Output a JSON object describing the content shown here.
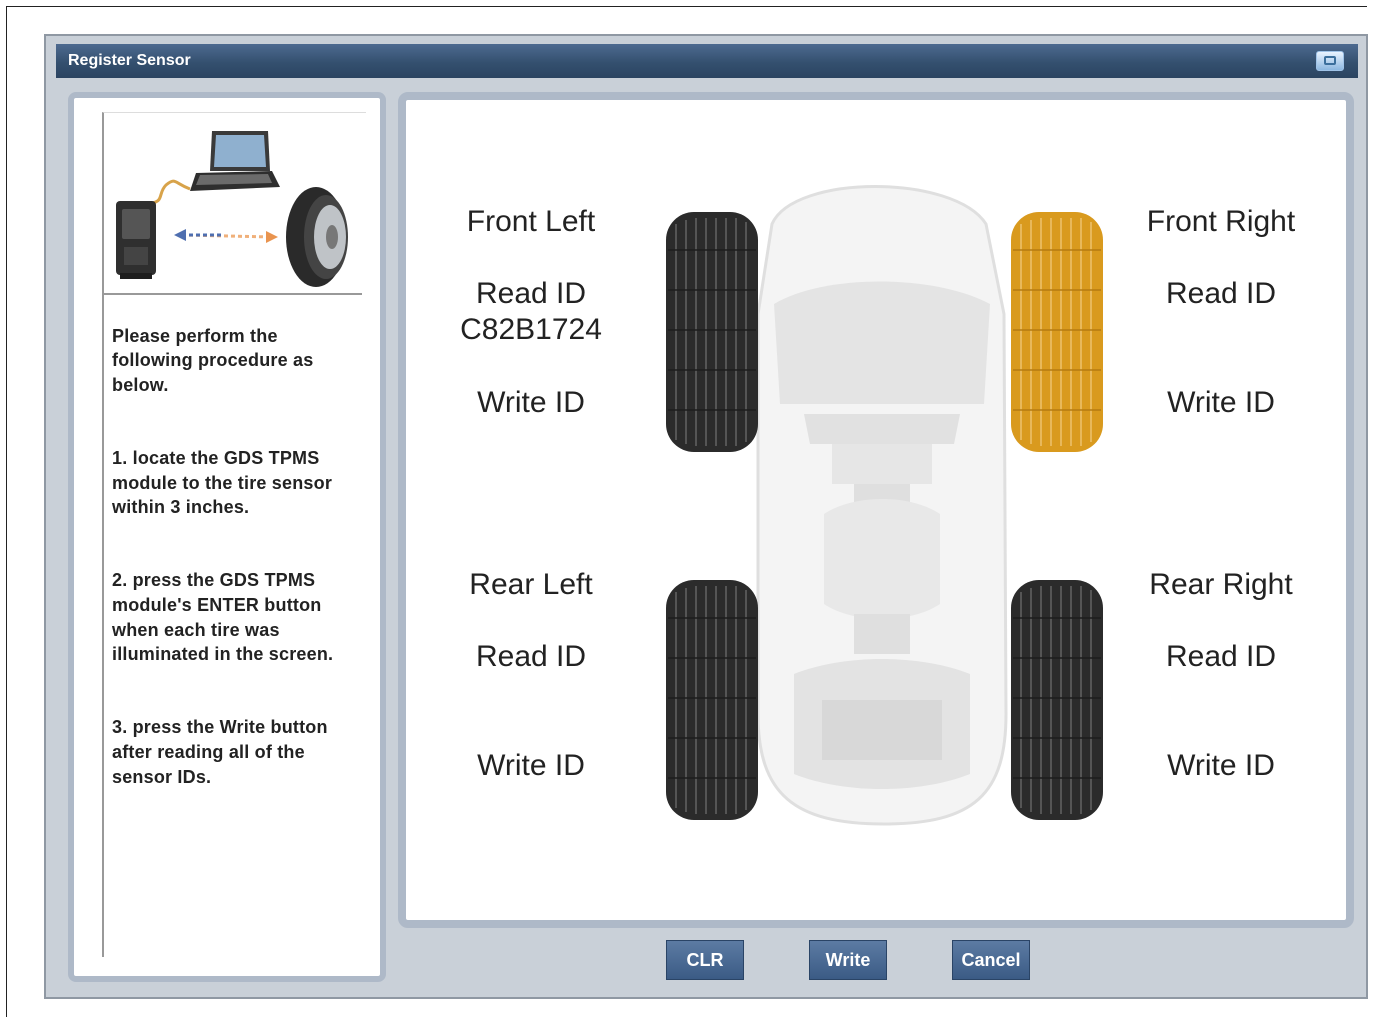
{
  "window": {
    "title": "Register Sensor"
  },
  "instructions": {
    "intro": "Please perform the following procedure as below.",
    "step1": "1. locate the GDS TPMS module to the tire sensor within 3 inches.",
    "step2": "2. press the GDS TPMS module's ENTER button when each tire was illuminated in the screen.",
    "step3": "3. press the Write button after reading all of the sensor IDs."
  },
  "wheels": {
    "front_left": {
      "name": "Front Left",
      "read_label": "Read ID",
      "read_value": "C82B1724",
      "write_label": "Write ID"
    },
    "front_right": {
      "name": "Front Right",
      "read_label": "Read ID",
      "read_value": "",
      "write_label": "Write ID",
      "highlighted": true
    },
    "rear_left": {
      "name": "Rear Left",
      "read_label": "Read ID",
      "read_value": "",
      "write_label": "Write ID"
    },
    "rear_right": {
      "name": "Rear Right",
      "read_label": "Read ID",
      "read_value": "",
      "write_label": "Write ID"
    }
  },
  "buttons": {
    "clr": "CLR",
    "write": "Write",
    "cancel": "Cancel"
  },
  "colors": {
    "title_bar": "#34506f",
    "button": "#3b5b85",
    "highlight_tire": "#d99a1e",
    "panel_border": "#aeb9c8"
  }
}
